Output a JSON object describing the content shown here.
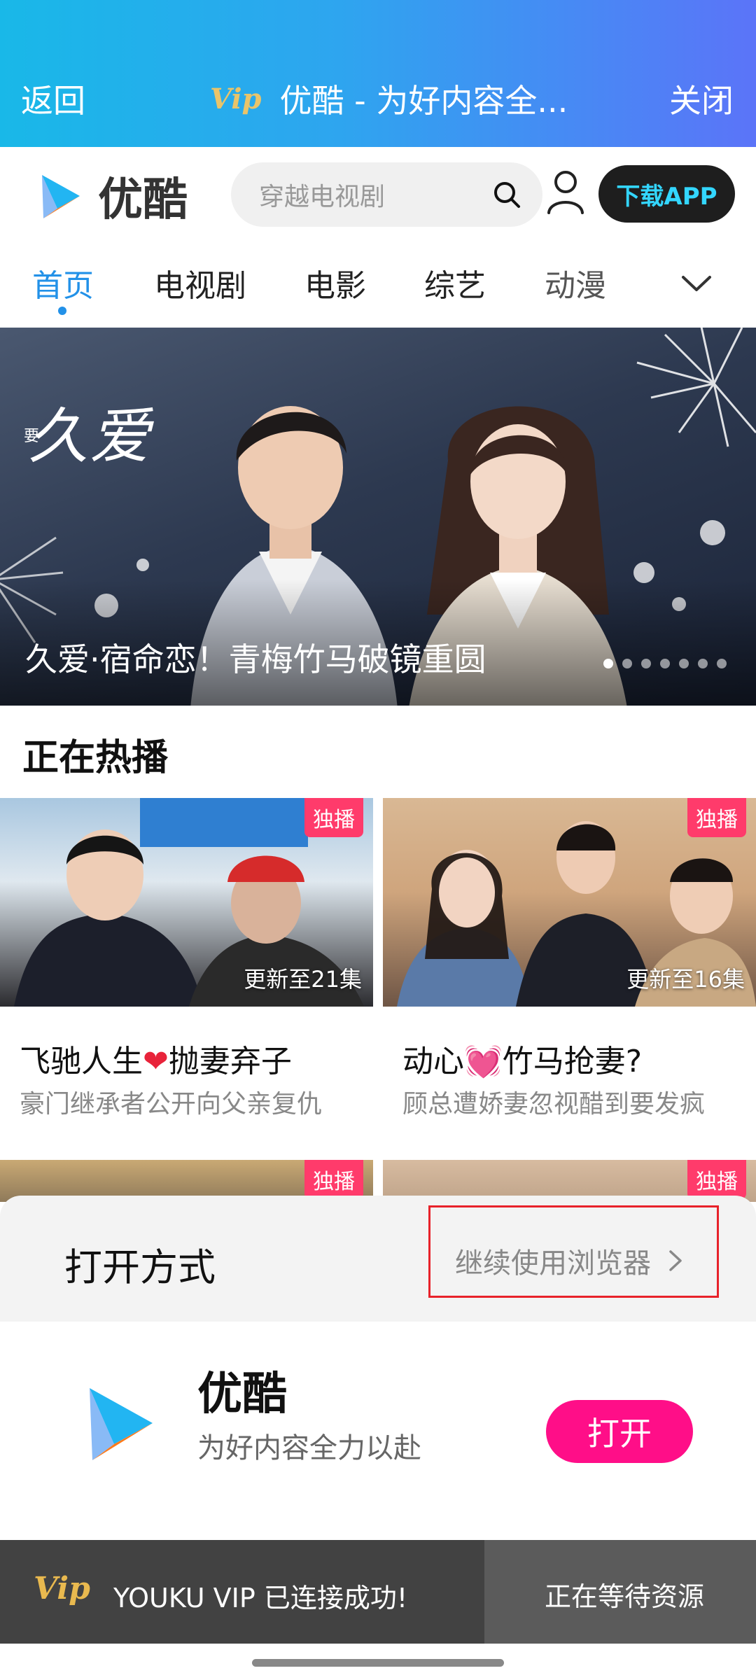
{
  "topbar": {
    "back_label": "返回",
    "vip_label": "Vip",
    "title": "优酷 - 为好内容全...",
    "close_label": "关闭"
  },
  "header": {
    "brand": "优酷",
    "search_placeholder": "穿越电视剧",
    "download_label": "下载APP"
  },
  "nav": {
    "tabs": [
      {
        "label": "首页",
        "active": true
      },
      {
        "label": "电视剧",
        "active": false
      },
      {
        "label": "电影",
        "active": false
      },
      {
        "label": "综艺",
        "active": false
      },
      {
        "label": "动漫",
        "active": false
      }
    ]
  },
  "banner": {
    "logo_text": "久爱",
    "logo_prefix": "要",
    "caption": "久爱·宿命恋！青梅竹马破镜重圆",
    "slide_count": 7,
    "active_slide": 1
  },
  "section": {
    "title": "正在热播"
  },
  "cards": [
    {
      "badge": "独播",
      "update": "更新至21集",
      "title_a": "飞驰人生",
      "title_b": "抛妻弃子",
      "subtitle": "豪门继承者公开向父亲复仇"
    },
    {
      "badge": "独播",
      "update": "更新至16集",
      "title_a": "动心",
      "title_b": "竹马抢妻?",
      "subtitle": "顾总遭娇妻忽视醋到要发疯"
    }
  ],
  "cards_row2": [
    {
      "badge": "独播"
    },
    {
      "badge": "独播"
    }
  ],
  "sheet": {
    "label": "打开方式",
    "continue_label": "继续使用浏览器",
    "app_name": "优酷",
    "app_desc": "为好内容全力以赴",
    "open_label": "打开"
  },
  "statusbar": {
    "vip_label": "Vip",
    "message": "YOUKU VIP 已连接成功!",
    "waiting": "正在等待资源"
  },
  "colors": {
    "accent_blue": "#2291e8",
    "open_pink": "#ff0e88",
    "badge_pink": "#ff3b6b",
    "highlight_red": "#e8222a"
  }
}
